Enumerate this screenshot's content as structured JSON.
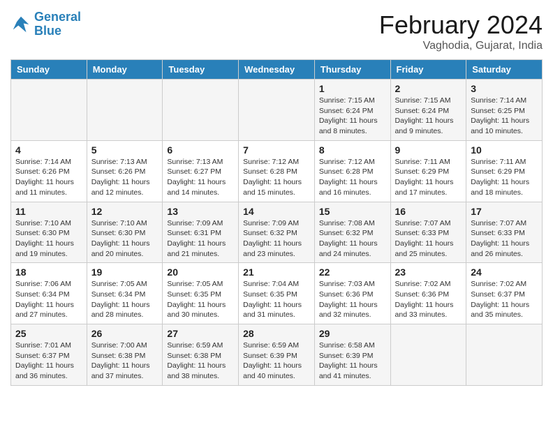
{
  "header": {
    "logo_line1": "General",
    "logo_line2": "Blue",
    "month_title": "February 2024",
    "subtitle": "Vaghodia, Gujarat, India"
  },
  "weekdays": [
    "Sunday",
    "Monday",
    "Tuesday",
    "Wednesday",
    "Thursday",
    "Friday",
    "Saturday"
  ],
  "weeks": [
    [
      {
        "day": "",
        "info": ""
      },
      {
        "day": "",
        "info": ""
      },
      {
        "day": "",
        "info": ""
      },
      {
        "day": "",
        "info": ""
      },
      {
        "day": "1",
        "info": "Sunrise: 7:15 AM\nSunset: 6:24 PM\nDaylight: 11 hours and 8 minutes."
      },
      {
        "day": "2",
        "info": "Sunrise: 7:15 AM\nSunset: 6:24 PM\nDaylight: 11 hours and 9 minutes."
      },
      {
        "day": "3",
        "info": "Sunrise: 7:14 AM\nSunset: 6:25 PM\nDaylight: 11 hours and 10 minutes."
      }
    ],
    [
      {
        "day": "4",
        "info": "Sunrise: 7:14 AM\nSunset: 6:26 PM\nDaylight: 11 hours and 11 minutes."
      },
      {
        "day": "5",
        "info": "Sunrise: 7:13 AM\nSunset: 6:26 PM\nDaylight: 11 hours and 12 minutes."
      },
      {
        "day": "6",
        "info": "Sunrise: 7:13 AM\nSunset: 6:27 PM\nDaylight: 11 hours and 14 minutes."
      },
      {
        "day": "7",
        "info": "Sunrise: 7:12 AM\nSunset: 6:28 PM\nDaylight: 11 hours and 15 minutes."
      },
      {
        "day": "8",
        "info": "Sunrise: 7:12 AM\nSunset: 6:28 PM\nDaylight: 11 hours and 16 minutes."
      },
      {
        "day": "9",
        "info": "Sunrise: 7:11 AM\nSunset: 6:29 PM\nDaylight: 11 hours and 17 minutes."
      },
      {
        "day": "10",
        "info": "Sunrise: 7:11 AM\nSunset: 6:29 PM\nDaylight: 11 hours and 18 minutes."
      }
    ],
    [
      {
        "day": "11",
        "info": "Sunrise: 7:10 AM\nSunset: 6:30 PM\nDaylight: 11 hours and 19 minutes."
      },
      {
        "day": "12",
        "info": "Sunrise: 7:10 AM\nSunset: 6:30 PM\nDaylight: 11 hours and 20 minutes."
      },
      {
        "day": "13",
        "info": "Sunrise: 7:09 AM\nSunset: 6:31 PM\nDaylight: 11 hours and 21 minutes."
      },
      {
        "day": "14",
        "info": "Sunrise: 7:09 AM\nSunset: 6:32 PM\nDaylight: 11 hours and 23 minutes."
      },
      {
        "day": "15",
        "info": "Sunrise: 7:08 AM\nSunset: 6:32 PM\nDaylight: 11 hours and 24 minutes."
      },
      {
        "day": "16",
        "info": "Sunrise: 7:07 AM\nSunset: 6:33 PM\nDaylight: 11 hours and 25 minutes."
      },
      {
        "day": "17",
        "info": "Sunrise: 7:07 AM\nSunset: 6:33 PM\nDaylight: 11 hours and 26 minutes."
      }
    ],
    [
      {
        "day": "18",
        "info": "Sunrise: 7:06 AM\nSunset: 6:34 PM\nDaylight: 11 hours and 27 minutes."
      },
      {
        "day": "19",
        "info": "Sunrise: 7:05 AM\nSunset: 6:34 PM\nDaylight: 11 hours and 28 minutes."
      },
      {
        "day": "20",
        "info": "Sunrise: 7:05 AM\nSunset: 6:35 PM\nDaylight: 11 hours and 30 minutes."
      },
      {
        "day": "21",
        "info": "Sunrise: 7:04 AM\nSunset: 6:35 PM\nDaylight: 11 hours and 31 minutes."
      },
      {
        "day": "22",
        "info": "Sunrise: 7:03 AM\nSunset: 6:36 PM\nDaylight: 11 hours and 32 minutes."
      },
      {
        "day": "23",
        "info": "Sunrise: 7:02 AM\nSunset: 6:36 PM\nDaylight: 11 hours and 33 minutes."
      },
      {
        "day": "24",
        "info": "Sunrise: 7:02 AM\nSunset: 6:37 PM\nDaylight: 11 hours and 35 minutes."
      }
    ],
    [
      {
        "day": "25",
        "info": "Sunrise: 7:01 AM\nSunset: 6:37 PM\nDaylight: 11 hours and 36 minutes."
      },
      {
        "day": "26",
        "info": "Sunrise: 7:00 AM\nSunset: 6:38 PM\nDaylight: 11 hours and 37 minutes."
      },
      {
        "day": "27",
        "info": "Sunrise: 6:59 AM\nSunset: 6:38 PM\nDaylight: 11 hours and 38 minutes."
      },
      {
        "day": "28",
        "info": "Sunrise: 6:59 AM\nSunset: 6:39 PM\nDaylight: 11 hours and 40 minutes."
      },
      {
        "day": "29",
        "info": "Sunrise: 6:58 AM\nSunset: 6:39 PM\nDaylight: 11 hours and 41 minutes."
      },
      {
        "day": "",
        "info": ""
      },
      {
        "day": "",
        "info": ""
      }
    ]
  ]
}
